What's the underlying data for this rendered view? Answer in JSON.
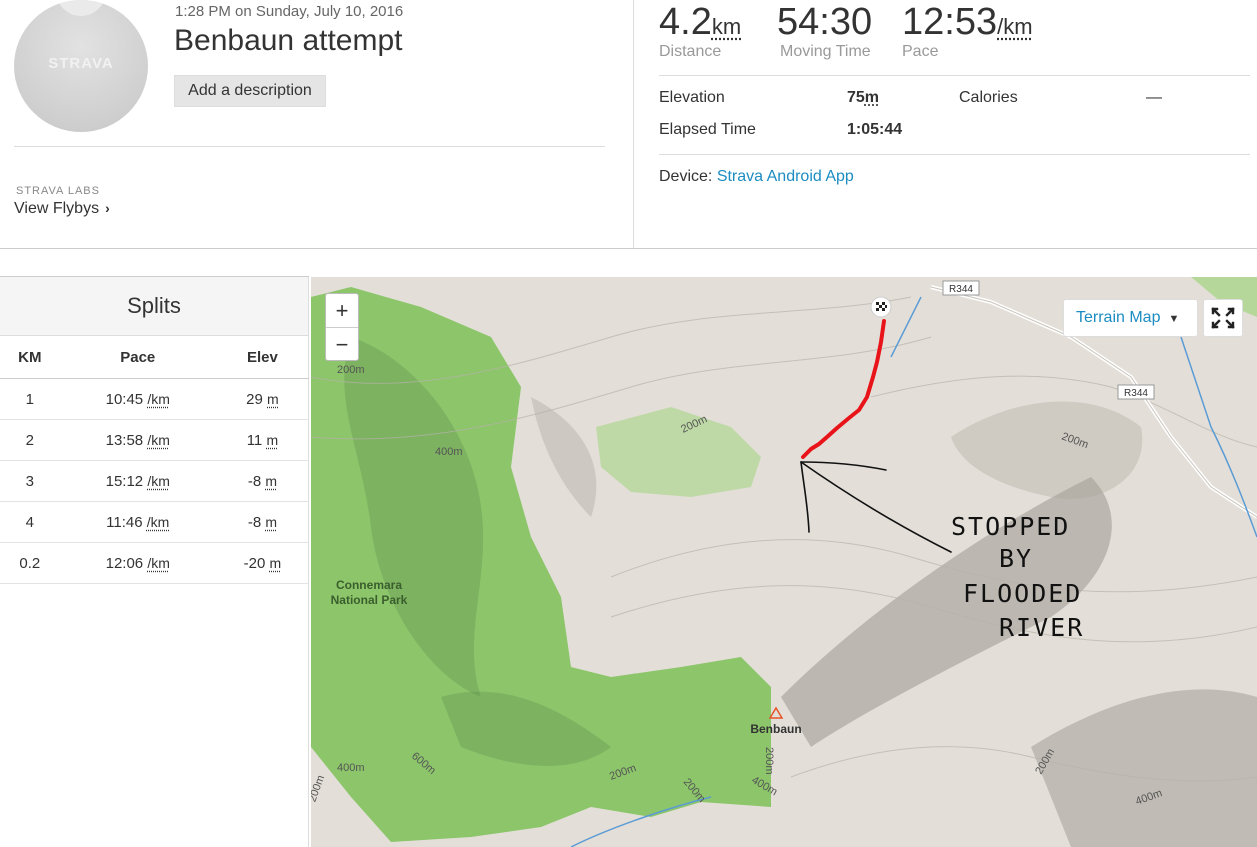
{
  "header": {
    "avatar_brand": "STRAVA",
    "datetime": "1:28 PM on Sunday, July 10, 2016",
    "title": "Benbaun attempt",
    "add_description": "Add a description",
    "labs_label": "STRAVA LABS",
    "flybys_label": "View Flybys",
    "flybys_chevron": "›"
  },
  "stats": {
    "distance": {
      "value": "4.2",
      "unit": "km",
      "label": "Distance"
    },
    "moving_time": {
      "value": "54:30",
      "label": "Moving Time"
    },
    "pace": {
      "value": "12:53",
      "unit": "/km",
      "label": "Pace"
    },
    "elevation": {
      "label": "Elevation",
      "value": "75",
      "unit": "m"
    },
    "calories": {
      "label": "Calories",
      "value": "—"
    },
    "elapsed": {
      "label": "Elapsed Time",
      "value": "1:05:44"
    },
    "device": {
      "label": "Device:",
      "value": "Strava Android App"
    }
  },
  "splits": {
    "title": "Splits",
    "columns": [
      "KM",
      "Pace",
      "Elev"
    ],
    "pace_unit": "/km",
    "elev_unit": "m",
    "rows": [
      {
        "km": "1",
        "pace": "10:45",
        "elev": "29"
      },
      {
        "km": "2",
        "pace": "13:58",
        "elev": "11"
      },
      {
        "km": "3",
        "pace": "15:12",
        "elev": "-8"
      },
      {
        "km": "4",
        "pace": "11:46",
        "elev": "-8"
      },
      {
        "km": "0.2",
        "pace": "12:06",
        "elev": "-20"
      }
    ]
  },
  "map": {
    "zoom_in": "+",
    "zoom_out": "−",
    "type_label": "Terrain Map",
    "caret": "▼",
    "road_labels": [
      "R344",
      "R344"
    ],
    "contours": [
      "200m",
      "400m",
      "200m",
      "200m",
      "200m",
      "400m",
      "600m",
      "200m",
      "200m",
      "400m",
      "200m",
      "400m",
      "200m"
    ],
    "park_label": [
      "Connemara",
      "National Park"
    ],
    "peak_label": "Benbaun",
    "annotation": [
      "STOPPED",
      "BY",
      "FLOODED",
      "RIVER"
    ],
    "colors": {
      "route": "#e8141a",
      "park": "#8cc56a",
      "terrain": "#e3dfd8",
      "water": "#5b9bd5",
      "link": "#1c8cc2"
    }
  }
}
